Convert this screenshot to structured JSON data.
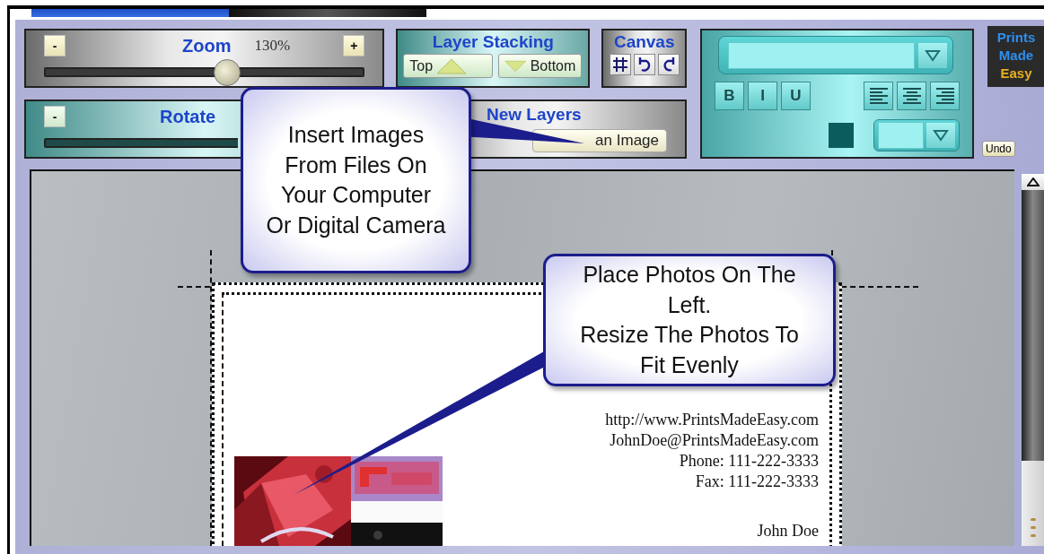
{
  "tabs": [
    {
      "selected": true
    },
    {
      "selected": false
    }
  ],
  "zoom": {
    "minus": "-",
    "title": "Zoom",
    "reading": "130%",
    "plus": "+",
    "level": 0.57
  },
  "layer_stacking": {
    "title": "Layer Stacking",
    "buttons": [
      "Top",
      "Bottom"
    ]
  },
  "canvas_tools": {
    "title": "Canvas"
  },
  "rotate": {
    "minus": "-",
    "title": "Rotate"
  },
  "new_layers": {
    "title": "New Layers",
    "button": "an Image"
  },
  "text_tools": {
    "style_buttons": [
      "B",
      "I",
      "U"
    ]
  },
  "logo": {
    "lines": [
      "Prints",
      "Made",
      "Easy"
    ]
  },
  "undo": "Undo",
  "card": {
    "lines": [
      "http://www.PrintsMadeEasy.com",
      "JohnDoe@PrintsMadeEasy.com",
      "Phone: 111-222-3333",
      "Fax: 111-222-3333"
    ],
    "name": "John Doe"
  },
  "callouts": [
    {
      "lines": [
        "Insert Images",
        "From Files On",
        "Your Computer",
        "Or Digital Camera"
      ]
    },
    {
      "lines": [
        "Place Photos On The",
        "Left.",
        "Resize The Photos To",
        "Fit Evenly"
      ]
    }
  ]
}
